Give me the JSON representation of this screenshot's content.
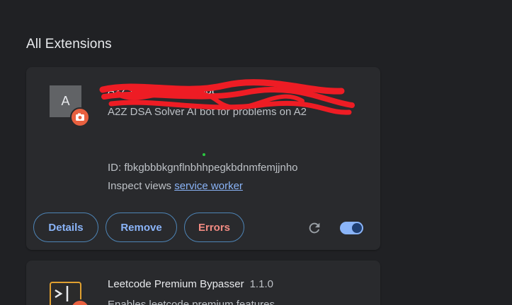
{
  "section_title": "All Extensions",
  "extensions": [
    {
      "avatar_letter": "A",
      "name": "A2Z DSA Solver AI bot",
      "description": "A2Z DSA Solver AI bot for problems on A2",
      "id_line": "ID: fbkgbbbkgnflnbhhpegkbdnmfemjjnho",
      "inspect_prefix": "Inspect views ",
      "inspect_link": "service worker",
      "buttons": {
        "details": "Details",
        "remove": "Remove",
        "errors": "Errors"
      },
      "enabled": true,
      "icons": {
        "badge": "camera-badge-icon",
        "reload": "reload-icon",
        "toggle": "enable-toggle"
      }
    },
    {
      "name": "Leetcode Premium Bypasser",
      "version": "1.1.0",
      "description": "Enables leetcode premium features",
      "icons": {
        "logo": "terminal-icon",
        "badge": "camera-badge-icon"
      }
    }
  ],
  "colors": {
    "background": "#202124",
    "card": "#292a2d",
    "accent": "#8ab4f8",
    "error": "#f28b82",
    "badge": "#e8603f"
  }
}
